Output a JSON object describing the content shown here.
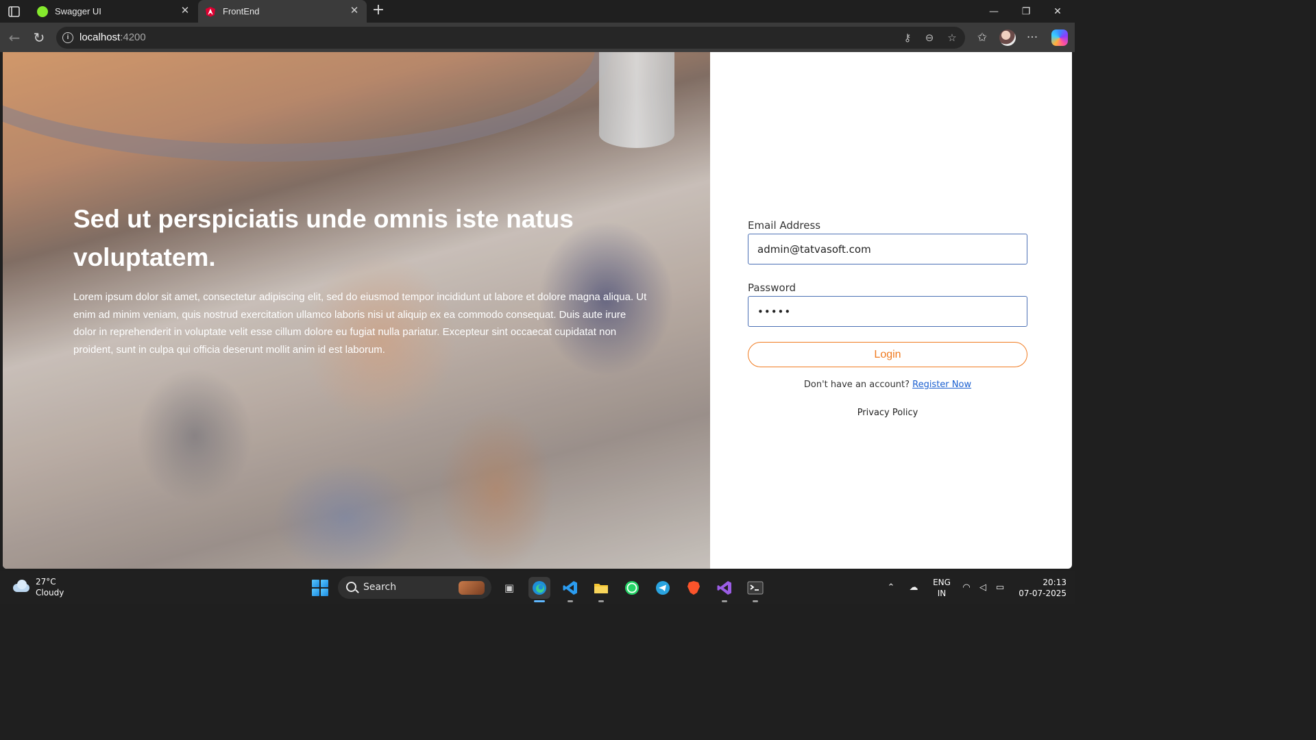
{
  "browser": {
    "tabs": [
      {
        "title": "Swagger UI",
        "favicon_color": "#85ea2d",
        "active": false
      },
      {
        "title": "FrontEnd",
        "favicon_color": "#dd0031",
        "active": true
      }
    ],
    "new_tab_glyph": "+",
    "address": {
      "host": "localhost",
      "port": ":4200"
    },
    "icons": [
      "sidebar-toggle-icon",
      "back-icon",
      "reload-icon",
      "site-info-icon",
      "key-icon",
      "zoom-icon",
      "favorite-star-icon",
      "favorites-icon",
      "profile-avatar",
      "more-icon",
      "copilot-icon"
    ]
  },
  "hero": {
    "title": "Sed ut perspiciatis unde omnis iste natus voluptatem.",
    "text": "Lorem ipsum dolor sit amet, consectetur adipiscing elit, sed do eiusmod tempor incididunt ut labore et dolore magna aliqua. Ut enim ad minim veniam, quis nostrud exercitation ullamco laboris nisi ut aliquip ex ea commodo consequat. Duis aute irure dolor in reprehenderit in voluptate velit esse cillum dolore eu fugiat nulla pariatur. Excepteur sint occaecat cupidatat non proident, sunt in culpa qui officia deserunt mollit anim id est laborum."
  },
  "login": {
    "email_label": "Email Address",
    "email_value": "admin@tatvasoft.com",
    "password_label": "Password",
    "password_value": "•••••",
    "login_button": "Login",
    "register_prompt": "Don't have an account?",
    "register_link": "Register Now",
    "privacy_link": "Privacy Policy",
    "accent_color": "#f07a1f",
    "input_border_color": "#4a6fb4"
  },
  "taskbar": {
    "weather": {
      "temp": "27°C",
      "condition": "Cloudy"
    },
    "search_label": "Search",
    "apps": [
      {
        "name": "task-view",
        "glyph": "▣",
        "color": "#cfcfcf"
      },
      {
        "name": "edge",
        "glyph": "e",
        "color": "#2fb7e6"
      },
      {
        "name": "vs-code",
        "glyph": "❯",
        "color": "#2b9cf0"
      },
      {
        "name": "file-explorer",
        "glyph": "▬",
        "color": "#f4c531"
      },
      {
        "name": "whatsapp",
        "glyph": "✆",
        "color": "#25d366"
      },
      {
        "name": "telegram",
        "glyph": "➤",
        "color": "#2aa4e0"
      },
      {
        "name": "brave",
        "glyph": "▼",
        "color": "#fb542b"
      },
      {
        "name": "visual-studio-preview",
        "glyph": "∞",
        "color": "#9b5de5"
      },
      {
        "name": "terminal",
        "glyph": ">_",
        "color": "#e0e0e0"
      }
    ],
    "language": {
      "line1": "ENG",
      "line2": "IN"
    },
    "clock": {
      "time": "20:13",
      "date": "07-07-2025"
    }
  }
}
